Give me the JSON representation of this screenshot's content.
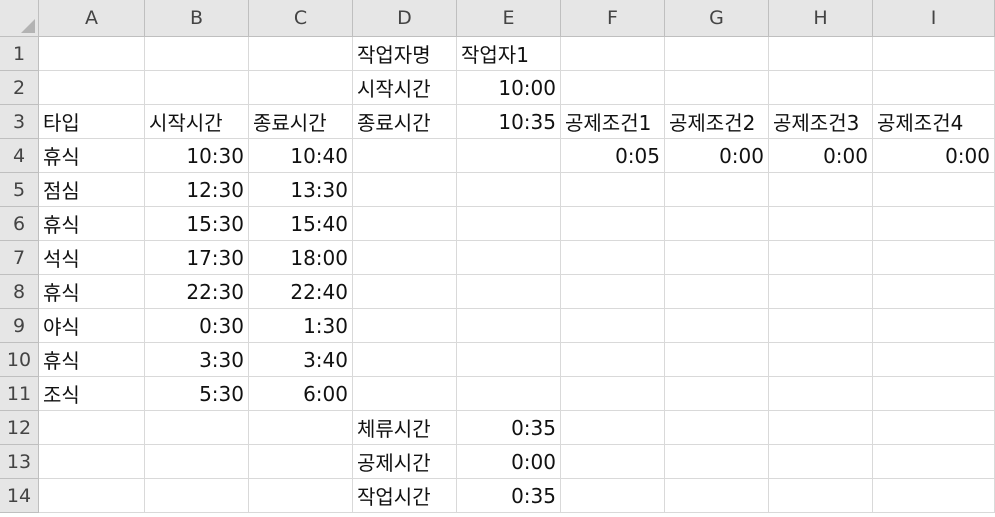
{
  "columns": [
    "A",
    "B",
    "C",
    "D",
    "E",
    "F",
    "G",
    "H",
    "I"
  ],
  "rows": [
    "1",
    "2",
    "3",
    "4",
    "5",
    "6",
    "7",
    "8",
    "9",
    "10",
    "11",
    "12",
    "13",
    "14"
  ],
  "cells": {
    "r1": [
      "",
      "",
      "",
      "작업자명",
      "작업자1",
      "",
      "",
      "",
      ""
    ],
    "r2": [
      "",
      "",
      "",
      "시작시간",
      "10:00",
      "",
      "",
      "",
      ""
    ],
    "r3": [
      "타입",
      "시작시간",
      "종료시간",
      "종료시간",
      "10:35",
      "공제조건1",
      "공제조건2",
      "공제조건3",
      "공제조건4"
    ],
    "r4": [
      "휴식",
      "10:30",
      "10:40",
      "",
      "",
      "0:05",
      "0:00",
      "0:00",
      "0:00"
    ],
    "r5": [
      "점심",
      "12:30",
      "13:30",
      "",
      "",
      "",
      "",
      "",
      ""
    ],
    "r6": [
      "휴식",
      "15:30",
      "15:40",
      "",
      "",
      "",
      "",
      "",
      ""
    ],
    "r7": [
      "석식",
      "17:30",
      "18:00",
      "",
      "",
      "",
      "",
      "",
      ""
    ],
    "r8": [
      "휴식",
      "22:30",
      "22:40",
      "",
      "",
      "",
      "",
      "",
      ""
    ],
    "r9": [
      "야식",
      "0:30",
      "1:30",
      "",
      "",
      "",
      "",
      "",
      ""
    ],
    "r10": [
      "휴식",
      "3:30",
      "3:40",
      "",
      "",
      "",
      "",
      "",
      ""
    ],
    "r11": [
      "조식",
      "5:30",
      "6:00",
      "",
      "",
      "",
      "",
      "",
      ""
    ],
    "r12": [
      "",
      "",
      "",
      "체류시간",
      "0:35",
      "",
      "",
      "",
      ""
    ],
    "r13": [
      "",
      "",
      "",
      "공제시간",
      "0:00",
      "",
      "",
      "",
      ""
    ],
    "r14": [
      "",
      "",
      "",
      "작업시간",
      "0:35",
      "",
      "",
      "",
      ""
    ]
  },
  "colors": {
    "header_bg": "#e6e6e6",
    "gridline": "#d9d9d9",
    "header_border": "#bfbfbf"
  },
  "icons": {
    "select_all": "select-all-triangle-icon"
  }
}
